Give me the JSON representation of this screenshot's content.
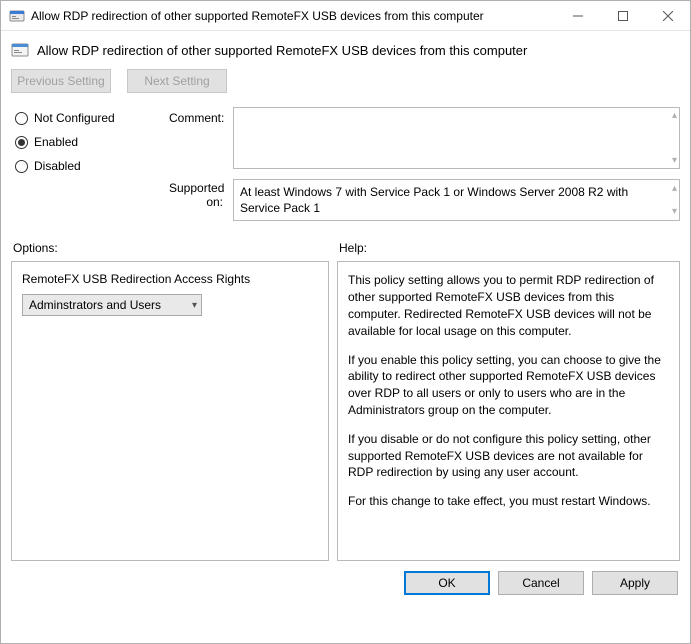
{
  "window": {
    "title": "Allow RDP redirection of other supported RemoteFX USB devices from this computer"
  },
  "header": {
    "title": "Allow RDP redirection of other supported RemoteFX USB devices from this computer"
  },
  "nav": {
    "previous": "Previous Setting",
    "next": "Next Setting"
  },
  "state": {
    "not_configured": "Not Configured",
    "enabled": "Enabled",
    "disabled": "Disabled",
    "selected": "enabled"
  },
  "labels": {
    "comment": "Comment:",
    "supported_on": "Supported on:",
    "options": "Options:",
    "help": "Help:"
  },
  "comment": "",
  "supported_on": "At least Windows 7 with Service Pack 1 or Windows Server 2008 R2 with Service Pack 1",
  "options": {
    "access_rights_label": "RemoteFX USB Redirection Access Rights",
    "access_rights_value": "Adminstrators and Users"
  },
  "help": {
    "p1": "This policy setting allows you to permit RDP redirection of other supported RemoteFX USB devices from this computer. Redirected RemoteFX USB devices will not be available for local usage on this computer.",
    "p2": "If you enable this policy setting, you can choose to give the ability to redirect other supported RemoteFX USB devices over RDP to all users or only to users who are in the Administrators group on the computer.",
    "p3": "If you disable or do not configure this policy setting, other supported RemoteFX USB devices are not available for RDP redirection by using any user account.",
    "p4": "For this change to take effect, you must restart Windows."
  },
  "footer": {
    "ok": "OK",
    "cancel": "Cancel",
    "apply": "Apply"
  }
}
